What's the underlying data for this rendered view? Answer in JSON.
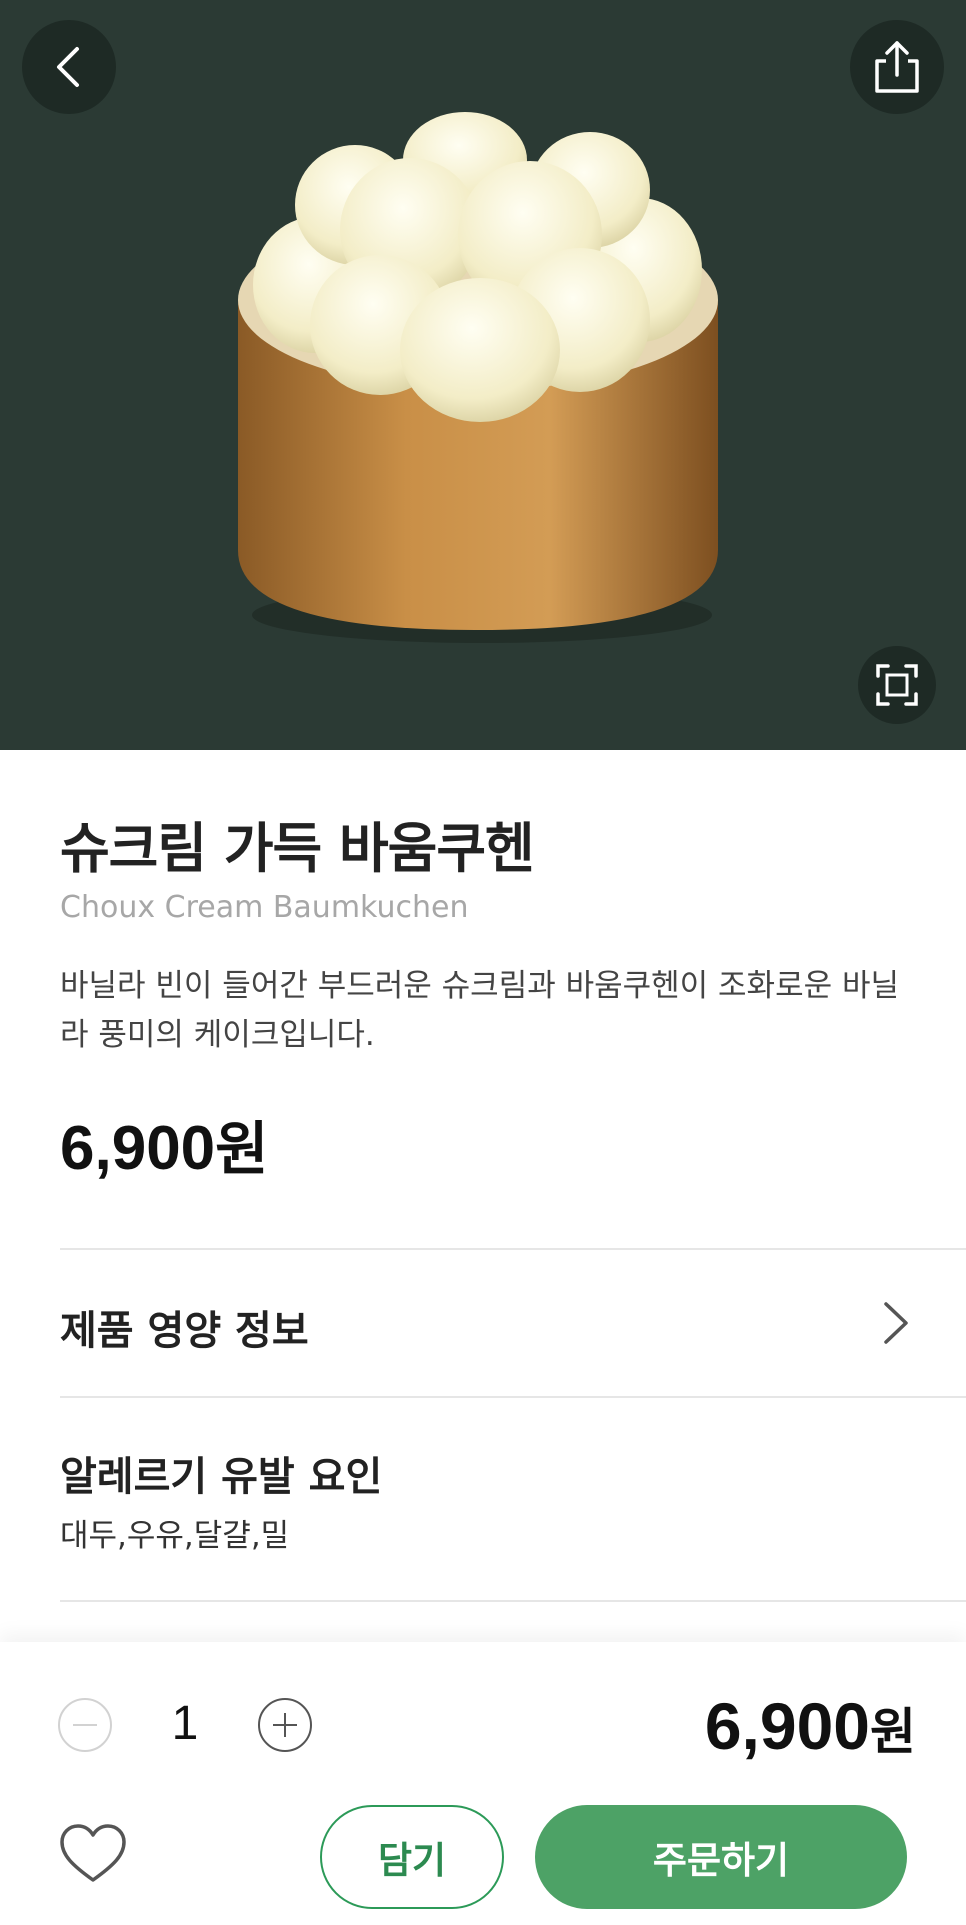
{
  "header": {
    "back_icon": "chevron-left-icon",
    "share_icon": "share-icon",
    "expand_icon": "fullscreen-icon",
    "background_color": "#2b3a34"
  },
  "product": {
    "name": "슈크림 가득 바움쿠헨",
    "name_en": "Choux Cream Baumkuchen",
    "description": "바닐라 빈이 들어간 부드러운 슈크림과 바움쿠헨이 조화로운 바닐라 풍미의 케이크입니다.",
    "price_number": "6,900",
    "price_unit": "원"
  },
  "nutrition": {
    "label": "제품 영양 정보"
  },
  "allergy": {
    "title": "알레르기 유발 요인",
    "value": "대두,우유,달걀,밀"
  },
  "order": {
    "quantity": "1",
    "total_number": "6,900",
    "total_unit": "원",
    "cart_label": "담기",
    "order_label": "주문하기",
    "accent_color": "#4da266"
  }
}
